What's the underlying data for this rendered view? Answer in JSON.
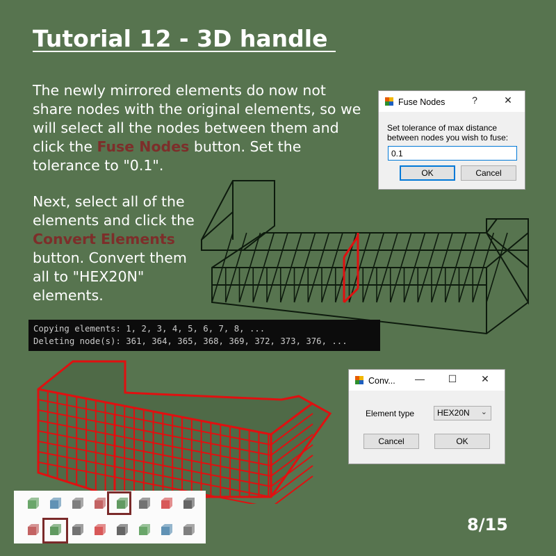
{
  "title": "Tutorial 12 - 3D handle ",
  "para1": {
    "pre": "The newly mirrored elements do now not share nodes with the original elements, so we will select all the nodes between them and click the ",
    "highlight": "Fuse Nodes",
    "post": " button. Set the tolerance to \"0.1\"."
  },
  "para2": {
    "pre": "Next, select all of the elements and click the ",
    "highlight": "Convert Elements",
    "post": " button. Convert them all to \"HEX20N\" elements."
  },
  "fuse_dialog": {
    "title": "Fuse Nodes",
    "help": "?",
    "close": "✕",
    "prompt": "Set tolerance of max distance between nodes you wish to fuse:",
    "value": "0.1",
    "ok": "OK",
    "cancel": "Cancel"
  },
  "console": {
    "line1": "Copying elements: 1, 2, 3, 4, 5, 6, 7, 8, ...",
    "line2": "Deleting node(s): 361, 364, 365, 368, 369, 372, 373, 376, ..."
  },
  "convert_dialog": {
    "title": "Conv...",
    "minimize": "—",
    "maximize": "☐",
    "close": "✕",
    "label": "Element type",
    "selected": "HEX20N",
    "cancel": "Cancel",
    "ok": "OK"
  },
  "toolbar": {
    "row1": [
      "create-elements-icon",
      "cube-icon",
      "wire-cube-icon",
      "tetra-icon",
      "fuse-nodes-icon",
      "mirror-icon",
      "line-icon",
      "beam-icon"
    ],
    "row2": [
      "node-icon",
      "convert-elements-icon",
      "points-icon",
      "scatter-icon",
      "split-icon",
      "merge-icon",
      "move-icon",
      "rotate-icon"
    ]
  },
  "colors": {
    "background": "#57744f",
    "highlight": "#7d2e2a",
    "mesh_red": "#e01010",
    "mesh_dark": "#0d1a0d"
  },
  "page": "8/15"
}
